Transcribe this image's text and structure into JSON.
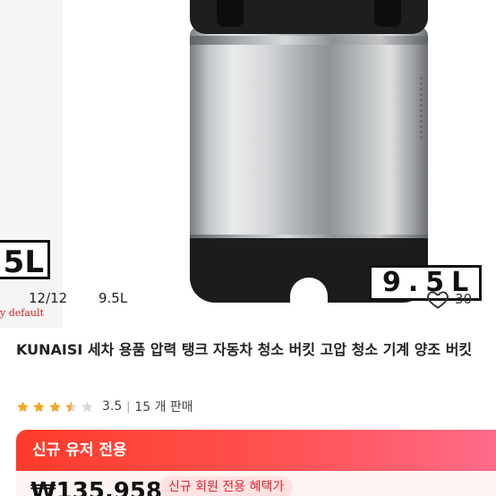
{
  "carousel": {
    "prev_slide_label": "5L",
    "prev_slide_caption": "y default",
    "current_slide_label": "9.5L",
    "counter": "12/12",
    "variant": "9.5L",
    "wishlist_count": "30"
  },
  "product": {
    "title": "KUNAISI 세차 용품 압력 탱크 자동차 청소 버킷 고압 청소 기계 양조 버킷",
    "rating": "3.5",
    "sold": "15 개 판매",
    "stars": 3.5
  },
  "promo": {
    "header": "신규 유저 전용",
    "price": "₩135,958",
    "badge": "신규 회원 전용 혜택가"
  },
  "colors": {
    "accent": "#ff3b2a",
    "star": "#f5a623"
  }
}
